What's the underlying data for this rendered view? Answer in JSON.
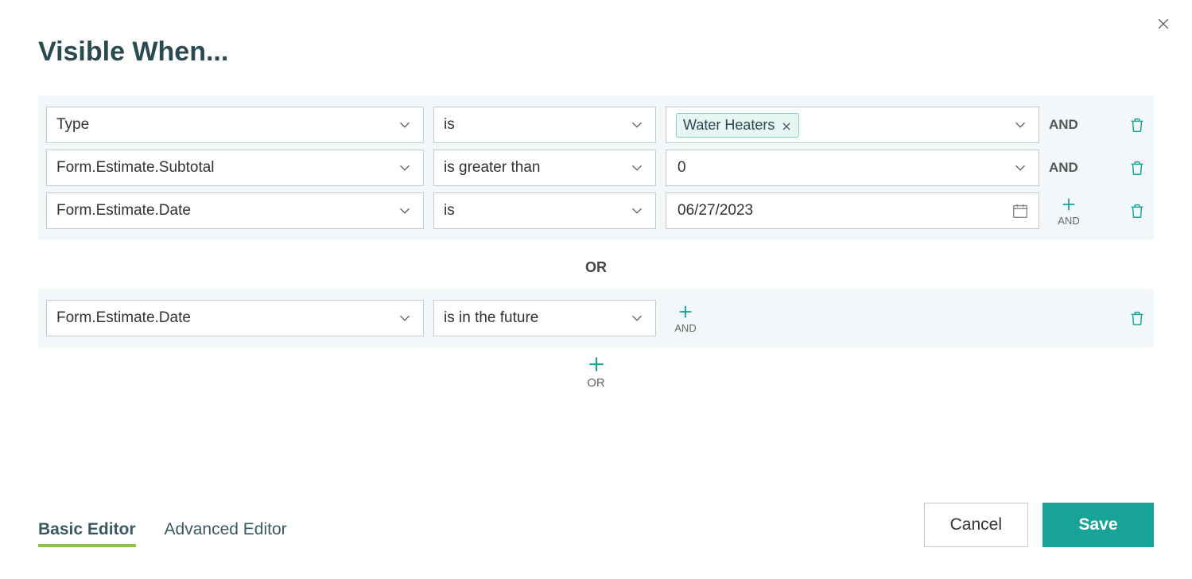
{
  "dialog": {
    "title": "Visible When..."
  },
  "groups": [
    {
      "conditions": [
        {
          "field": "Type",
          "operator": "is",
          "value_type": "tags",
          "tags": [
            "Water Heaters"
          ],
          "after": "AND"
        },
        {
          "field": "Form.Estimate.Subtotal",
          "operator": "is greater than",
          "value_type": "text",
          "value": "0",
          "after": "AND"
        },
        {
          "field": "Form.Estimate.Date",
          "operator": "is",
          "value_type": "date",
          "value": "06/27/2023",
          "after": "ADD_AND"
        }
      ]
    },
    {
      "conditions": [
        {
          "field": "Form.Estimate.Date",
          "operator": "is in the future",
          "value_type": "none",
          "after": "ADD_AND"
        }
      ]
    }
  ],
  "or_label": "OR",
  "add_and_label": "AND",
  "add_or_label": "OR",
  "tabs": {
    "basic": "Basic Editor",
    "advanced": "Advanced Editor",
    "active": "basic"
  },
  "buttons": {
    "cancel": "Cancel",
    "save": "Save"
  }
}
